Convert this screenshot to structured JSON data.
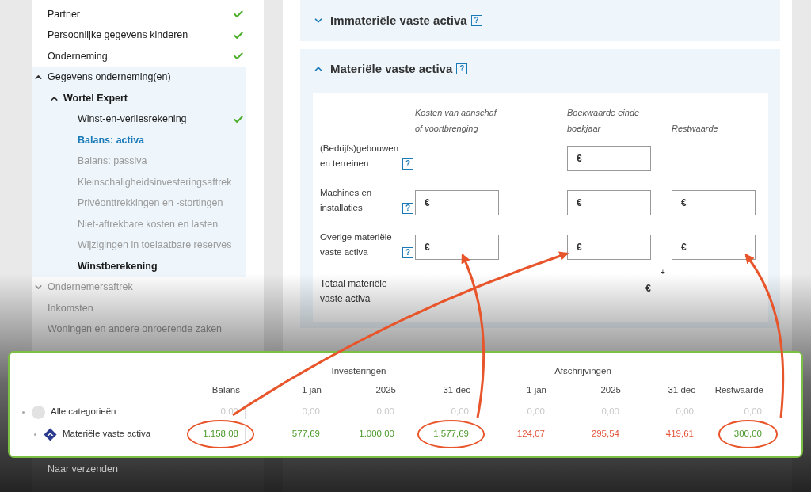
{
  "sidebar": {
    "items": [
      {
        "label": "Partner",
        "checked": true
      },
      {
        "label": "Persoonlijke gegevens kinderen",
        "checked": true
      },
      {
        "label": "Onderneming",
        "checked": true
      },
      {
        "label": "Gegevens onderneming(en)",
        "expanded": true,
        "children": [
          {
            "label": "Wortel Expert",
            "expanded": true,
            "bold": true,
            "children": [
              {
                "label": "Winst-en-verliesrekening",
                "checked": true
              },
              {
                "label": "Balans: activa",
                "selected": true
              },
              {
                "label": "Balans: passiva",
                "disabled": true
              },
              {
                "label": "Kleinschaligheidsinvesteringsaftrek",
                "disabled": true
              },
              {
                "label": "Privéonttrekkingen en -stortingen",
                "disabled": true
              },
              {
                "label": "Niet-aftrekbare kosten en lasten",
                "disabled": true
              },
              {
                "label": "Wijzigingen in toelaatbare reserves",
                "disabled": true
              },
              {
                "label": "Winstberekening",
                "bold": true
              }
            ]
          }
        ]
      },
      {
        "label": "Ondernemersaftrek",
        "expanded": false,
        "disabled": true
      },
      {
        "label": "Inkomsten",
        "disabled": true
      },
      {
        "label": "Woningen en andere onroerende zaken",
        "disabled": true
      },
      {
        "label": "Naar verzenden",
        "disabled": true
      }
    ]
  },
  "sections": [
    {
      "title": "Immateriële vaste activa",
      "help": "?",
      "expanded": false
    },
    {
      "title": "Materiële vaste activa",
      "help": "?",
      "expanded": true,
      "columns": [
        "Kosten van aanschaf of voortbrenging",
        "Boekwaarde einde boekjaar",
        "Restwaarde"
      ],
      "rows": [
        {
          "label": "(Bedrijfs)gebouwen en terreinen",
          "help": "?",
          "fields": [
            {
              "kind": "empty"
            },
            {
              "kind": "field",
              "prefix": "€"
            },
            {
              "kind": "empty"
            }
          ]
        },
        {
          "label": "Machines en installaties",
          "help": "?",
          "fields": [
            {
              "kind": "field",
              "prefix": "€"
            },
            {
              "kind": "field",
              "prefix": "€"
            },
            {
              "kind": "field",
              "prefix": "€"
            }
          ]
        },
        {
          "label": "Overige materiële vaste activa",
          "help": "?",
          "fields": [
            {
              "kind": "field",
              "prefix": "€"
            },
            {
              "kind": "field",
              "prefix": "€"
            },
            {
              "kind": "field",
              "prefix": "€"
            }
          ]
        }
      ],
      "total": {
        "label": "Totaal materiële vaste activa",
        "sign": "+",
        "currency": "€"
      }
    }
  ],
  "overview": {
    "groups": [
      "Investeringen",
      "Afschrijvingen"
    ],
    "columns": [
      "Balans",
      "1 jan",
      "2025",
      "31 dec",
      "1 jan",
      "2025",
      "31 dec",
      "Restwaarde"
    ],
    "rows": [
      {
        "label": "Alle categorieën",
        "kind": "circle",
        "values": [
          {
            "text": "0,00",
            "color": "#c8c8c8",
            "circled": false
          },
          {
            "text": "0,00",
            "color": "#c8c8c8",
            "circled": false
          },
          {
            "text": "0,00",
            "color": "#c8c8c8",
            "circled": false
          },
          {
            "text": "0,00",
            "color": "#c8c8c8",
            "circled": false
          },
          {
            "text": "0,00",
            "color": "#c8c8c8",
            "circled": false
          },
          {
            "text": "0,00",
            "color": "#c8c8c8",
            "circled": false
          },
          {
            "text": "0,00",
            "color": "#c8c8c8",
            "circled": false
          },
          {
            "text": "0,00",
            "color": "#c8c8c8",
            "circled": false
          }
        ],
        "children": [
          {
            "label": "Materiële vaste activa",
            "kind": "diamond",
            "values": [
              {
                "text": "1.158,08",
                "color": "#4b9a2a",
                "circled": true
              },
              {
                "text": "577,69",
                "color": "#4b9a2a",
                "circled": false
              },
              {
                "text": "1.000,00",
                "color": "#4b9a2a",
                "circled": false
              },
              {
                "text": "1.577,69",
                "color": "#4b9a2a",
                "circled": true
              },
              {
                "text": "124,07",
                "color": "#e4573d",
                "circled": false
              },
              {
                "text": "295,54",
                "color": "#e4573d",
                "circled": false
              },
              {
                "text": "419,61",
                "color": "#e4573d",
                "circled": false
              },
              {
                "text": "300,00",
                "color": "#4b9a2a",
                "circled": true
              }
            ]
          }
        ]
      }
    ]
  }
}
